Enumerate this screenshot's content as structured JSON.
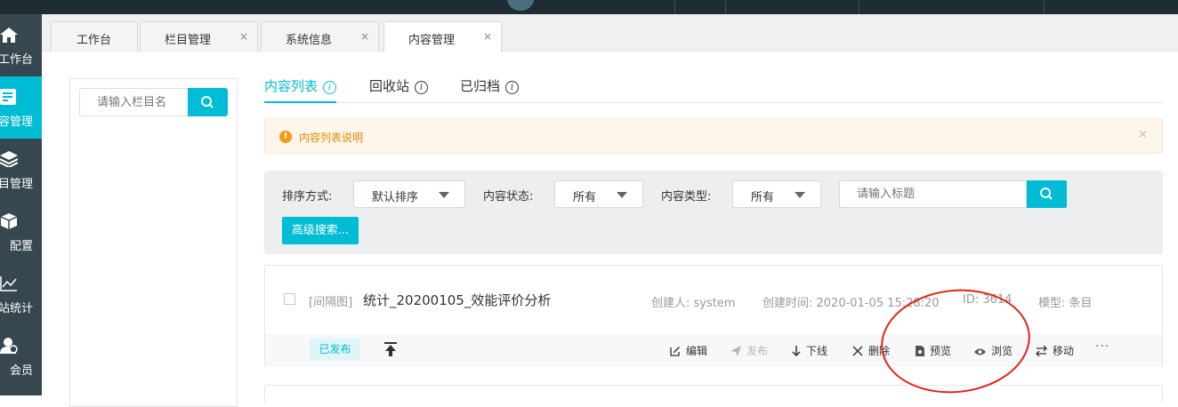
{
  "sidebar": {
    "items": [
      {
        "label": "工作台",
        "icon": "home-icon"
      },
      {
        "label": "容管理",
        "icon": "content-icon",
        "active": true
      },
      {
        "label": "目管理",
        "icon": "layers-icon"
      },
      {
        "label": "配置",
        "icon": "box-icon"
      },
      {
        "label": "站统计",
        "icon": "chart-icon"
      },
      {
        "label": "会员",
        "icon": "user-icon"
      }
    ]
  },
  "tabs": [
    {
      "label": "工作台",
      "closable": false
    },
    {
      "label": "栏目管理",
      "close": "×"
    },
    {
      "label": "系统信息",
      "close": "×"
    },
    {
      "label": "内容管理",
      "close": "×",
      "active": true
    }
  ],
  "tree": {
    "search_placeholder": "请输入栏目名"
  },
  "content_tabs": [
    {
      "label": "内容列表",
      "info": "i",
      "active": true
    },
    {
      "label": "回收站",
      "info": "i"
    },
    {
      "label": "已归档",
      "info": "i"
    }
  ],
  "notice": {
    "icon": "!",
    "text": "内容列表说明",
    "close": "×",
    "color": "#e68a00"
  },
  "filters": {
    "sort_label": "排序方式:",
    "sort_value": "默认排序",
    "status_label": "内容状态:",
    "status_value": "所有",
    "type_label": "内容类型:",
    "type_value": "所有",
    "title_placeholder": "请输入标题",
    "advanced_label": "高级搜索..."
  },
  "item": {
    "tag": "[间隔图]",
    "title": "统计_20200105_效能评价分析",
    "creator": "创建人: system",
    "created": "创建时间: 2020-01-05 15:28:20",
    "id": "ID: 3614",
    "model": "模型: 条目",
    "status": "已发布",
    "actions": {
      "edit": "编辑",
      "publish": "发布",
      "offline": "下线",
      "delete": "删除",
      "preview": "预览",
      "browse": "浏览",
      "move": "移动",
      "more": "···"
    }
  },
  "colors": {
    "accent": "#00bcd4",
    "sidebar": "#37474f",
    "annotation": "#e5201a"
  }
}
